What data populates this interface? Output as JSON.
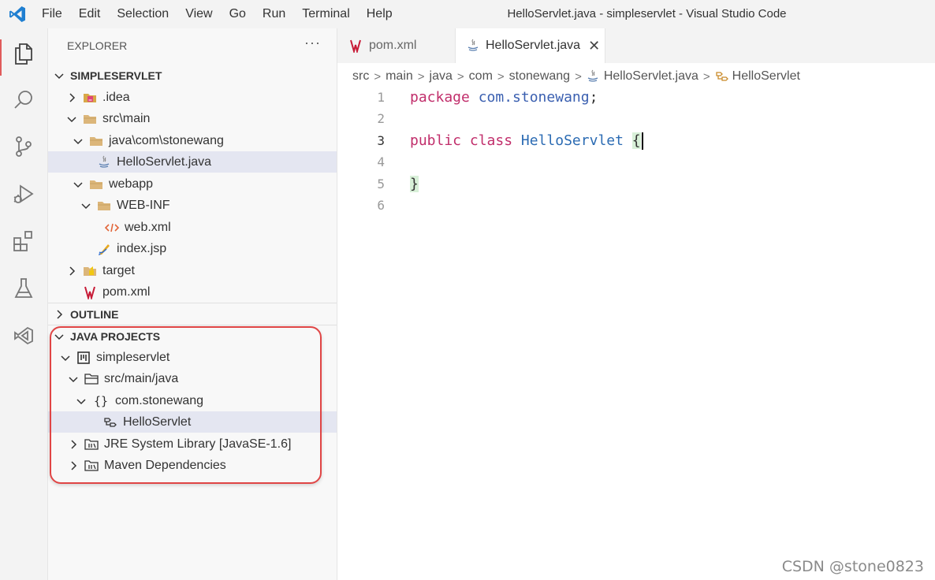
{
  "menu": [
    "File",
    "Edit",
    "Selection",
    "View",
    "Go",
    "Run",
    "Terminal",
    "Help"
  ],
  "window_title": "HelloServlet.java - simpleservlet - Visual Studio Code",
  "activity_icons": [
    "explorer-icon",
    "search-icon",
    "source-control-icon",
    "run-debug-icon",
    "extensions-icon",
    "testing-icon",
    "remote-icon"
  ],
  "sidebar": {
    "title": "EXPLORER",
    "more": "···",
    "workspace": "SIMPLESERVLET",
    "tree": [
      {
        "label": ".idea",
        "icon": "idea-folder-icon",
        "chevron": "right"
      },
      {
        "label": "src\\main",
        "icon": "folder-icon",
        "chevron": "down"
      },
      {
        "label": "java\\com\\stonewang",
        "icon": "folder-icon",
        "chevron": "down"
      },
      {
        "label": "HelloServlet.java",
        "icon": "java-file-icon",
        "chevron": "none",
        "selected": true
      },
      {
        "label": "webapp",
        "icon": "folder-icon",
        "chevron": "down"
      },
      {
        "label": "WEB-INF",
        "icon": "folder-icon",
        "chevron": "down"
      },
      {
        "label": "web.xml",
        "icon": "xml-file-icon",
        "chevron": "none"
      },
      {
        "label": "index.jsp",
        "icon": "jsp-file-icon",
        "chevron": "none"
      },
      {
        "label": "target",
        "icon": "target-folder-icon",
        "chevron": "right"
      },
      {
        "label": "pom.xml",
        "icon": "maven-file-icon",
        "chevron": "none"
      }
    ],
    "outline": "OUTLINE",
    "java_projects": "JAVA PROJECTS",
    "projects_tree": [
      {
        "label": "simpleservlet",
        "icon": "project-icon",
        "chevron": "down"
      },
      {
        "label": "src/main/java",
        "icon": "source-folder-icon",
        "chevron": "down"
      },
      {
        "label": "com.stonewang",
        "icon": "package-icon",
        "chevron": "down"
      },
      {
        "label": "HelloServlet",
        "icon": "class-icon",
        "chevron": "none",
        "selected": true
      },
      {
        "label": "JRE System Library [JavaSE-1.6]",
        "icon": "library-icon",
        "chevron": "right"
      },
      {
        "label": "Maven Dependencies",
        "icon": "library-icon",
        "chevron": "right"
      }
    ]
  },
  "tabs": [
    {
      "label": "pom.xml",
      "icon": "maven-file-icon",
      "active": false
    },
    {
      "label": "HelloServlet.java",
      "icon": "java-file-icon",
      "active": true,
      "close": "✕"
    }
  ],
  "breadcrumb": [
    "src",
    "main",
    "java",
    "com",
    "stonewang",
    "HelloServlet.java",
    "HelloServlet"
  ],
  "code": {
    "line_numbers": [
      "1",
      "2",
      "3",
      "4",
      "5",
      "6"
    ],
    "current_line": "3",
    "l1_kw": "package",
    "l1_pkg": "com.stonewang",
    "l1_end": ";",
    "l3_kw1": "public",
    "l3_kw2": "class",
    "l3_cls": "HelloServlet",
    "l3_brace": "{",
    "l5_brace": "}"
  },
  "colors": {
    "keyword": "#c12e6b",
    "highlight_box": "#e04545",
    "selection": "#e4e6f1"
  },
  "watermark": "CSDN @stone0823"
}
